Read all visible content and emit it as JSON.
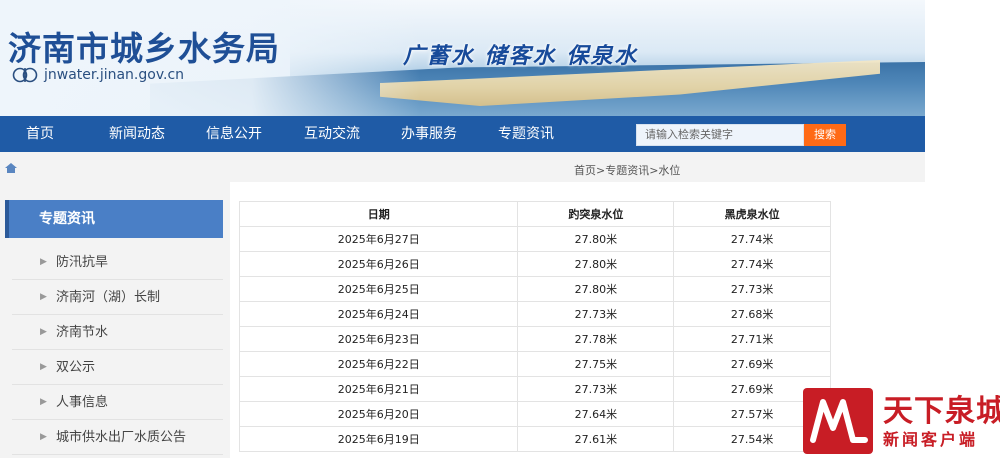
{
  "header": {
    "site_title": "济南市城乡水务局",
    "site_url": "jnwater.jinan.gov.cn",
    "slogan": "广蓄水  储客水  保泉水"
  },
  "nav": {
    "items": [
      "首页",
      "新闻动态",
      "信息公开",
      "互动交流",
      "办事服务",
      "专题资讯"
    ],
    "search_placeholder": "请输入检索关键字",
    "search_button": "搜索"
  },
  "breadcrumb": "首页>专题资讯>水位",
  "sidebar": {
    "title": "专题资讯",
    "items": [
      "防汛抗旱",
      "济南河（湖）长制",
      "济南节水",
      "双公示",
      "人事信息",
      "城市供水出厂水质公告"
    ]
  },
  "table": {
    "headers": [
      "日期",
      "趵突泉水位",
      "黑虎泉水位"
    ],
    "rows": [
      [
        "2025年6月27日",
        "27.80米",
        "27.74米"
      ],
      [
        "2025年6月26日",
        "27.80米",
        "27.74米"
      ],
      [
        "2025年6月25日",
        "27.80米",
        "27.73米"
      ],
      [
        "2025年6月24日",
        "27.73米",
        "27.68米"
      ],
      [
        "2025年6月23日",
        "27.78米",
        "27.71米"
      ],
      [
        "2025年6月22日",
        "27.75米",
        "27.69米"
      ],
      [
        "2025年6月21日",
        "27.73米",
        "27.69米"
      ],
      [
        "2025年6月20日",
        "27.64米",
        "27.57米"
      ],
      [
        "2025年6月19日",
        "27.61米",
        "27.54米"
      ]
    ]
  },
  "watermark": {
    "main": "天下泉城",
    "sub": "新闻客户端"
  },
  "colors": {
    "nav_bg": "#1f5ba6",
    "sidebar_head": "#4a7fc6",
    "search_button": "#ff6a16",
    "title": "#1f4f96",
    "watermark": "#c81d25"
  }
}
